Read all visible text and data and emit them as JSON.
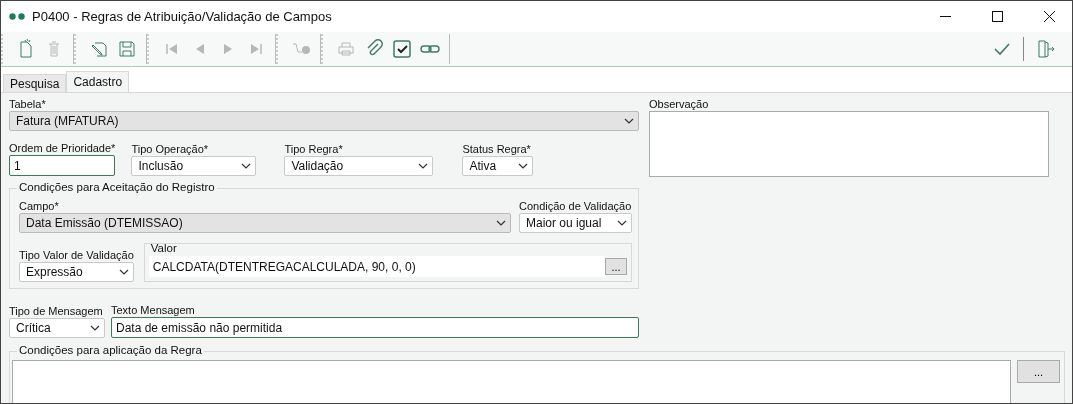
{
  "window": {
    "title": "P0400 - Regras de Atribuição/Validação de Campos"
  },
  "toolbar": {
    "groups": [
      [
        {
          "kind": "new",
          "disabled": false
        },
        {
          "kind": "delete",
          "disabled": true
        }
      ],
      [
        {
          "kind": "edit",
          "disabled": false
        },
        {
          "kind": "save",
          "disabled": false
        }
      ],
      [
        {
          "kind": "first",
          "disabled": true
        },
        {
          "kind": "prev",
          "disabled": true
        },
        {
          "kind": "next",
          "disabled": true
        },
        {
          "kind": "last",
          "disabled": true
        }
      ],
      [
        {
          "kind": "search",
          "disabled": true
        }
      ],
      [
        {
          "kind": "print",
          "disabled": true
        },
        {
          "kind": "attach",
          "disabled": false
        },
        {
          "kind": "check",
          "disabled": false
        },
        {
          "kind": "link",
          "disabled": false
        }
      ]
    ],
    "right": [
      {
        "kind": "confirm",
        "disabled": false
      },
      {
        "kind": "exit",
        "disabled": false
      }
    ]
  },
  "tabs": [
    {
      "label": "Pesquisa",
      "selected": false
    },
    {
      "label": "Cadastro",
      "selected": true
    }
  ],
  "form": {
    "tabela": {
      "label": "Tabela*",
      "value": "Fatura (MFATURA)"
    },
    "row2": [
      {
        "kind": "input",
        "label": "Ordem de Prioridade*",
        "value": "1",
        "focused": true
      },
      {
        "kind": "select",
        "label": "Tipo Operação*",
        "value": "Inclusão"
      },
      {
        "kind": "select",
        "label": "Tipo Regra*",
        "value": "Validação"
      },
      {
        "kind": "select",
        "label": "Status Regra*",
        "value": "Ativa"
      }
    ],
    "aceitacao": {
      "title": "Condições para Aceitação do Registro",
      "campo": {
        "label": "Campo*",
        "value": "Data Emissão (DTEMISSAO)"
      },
      "condicao": {
        "label": "Condição de Validação",
        "value": "Maior ou igual"
      },
      "tipo_valor": {
        "label": "Tipo Valor de Validação",
        "value": "Expressão"
      },
      "valor": {
        "label": "Valor",
        "value": "CALCDATA(DTENTREGACALCULADA, 90, 0, 0)",
        "button": "..."
      }
    },
    "tipo_mensagem": {
      "label": "Tipo de Mensagem",
      "value": "Crítica"
    },
    "texto_mensagem": {
      "label": "Texto Mensagem",
      "value": "Data de emissão não permitida"
    },
    "aplicacao": {
      "title": "Condições para aplicação da Regra",
      "button": "..."
    }
  },
  "observacao": {
    "label": "Observação"
  }
}
